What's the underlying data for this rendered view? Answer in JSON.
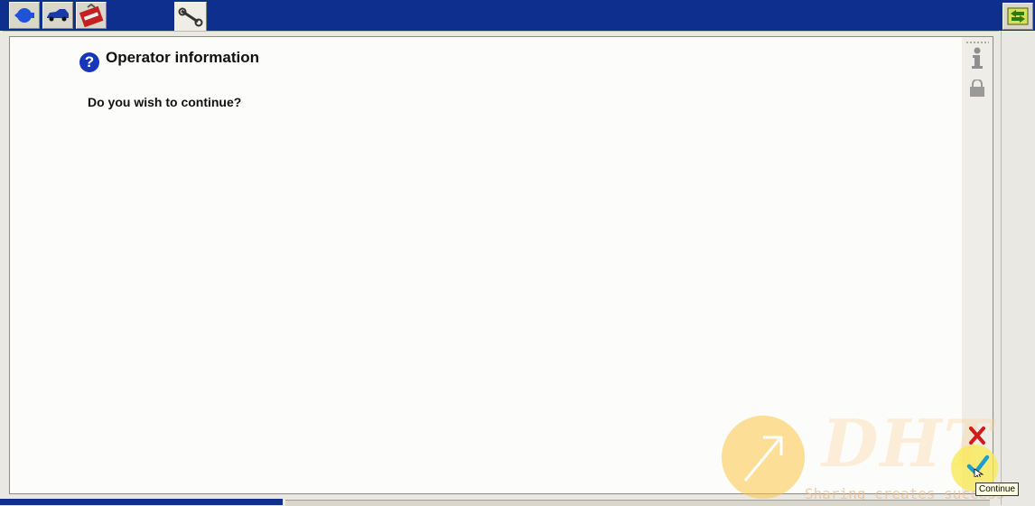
{
  "toolbar": {
    "tabs": [
      {
        "name": "back-arrow-icon"
      },
      {
        "name": "vehicle-icon"
      },
      {
        "name": "toolbox-icon"
      },
      {
        "name": "wrench-icon"
      }
    ],
    "right_button_icon": "swap-arrows-icon"
  },
  "dialog": {
    "title": "Operator information",
    "question": "Do you wish to continue?"
  },
  "side_panel": {
    "icons": [
      "info-icon",
      "lock-icon"
    ],
    "cancel_icon": "cancel-x-icon",
    "continue_icon": "checkmark-icon",
    "tooltip": "Continue"
  },
  "watermark": {
    "brand": "DHT",
    "slogan": "Sharing creates success"
  },
  "colors": {
    "title_bar": "#0f2f8e",
    "help_icon": "#1737b9",
    "cancel": "#d21a1a",
    "continue": "#1a9fd0"
  }
}
